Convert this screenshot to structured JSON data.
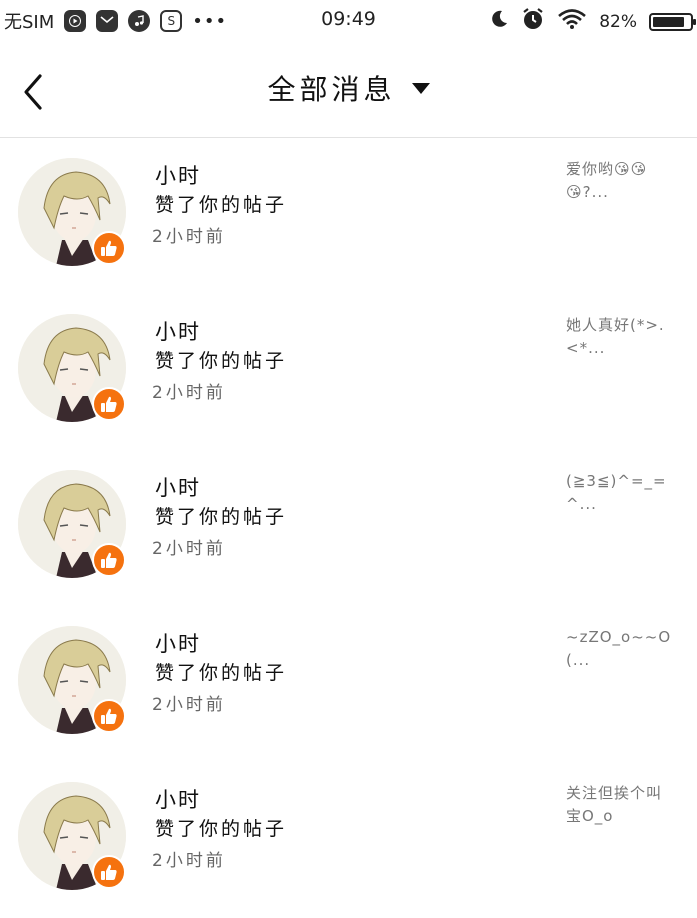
{
  "status_bar": {
    "carrier": "无SIM",
    "time": "09:49",
    "battery_percent": "82%",
    "battery_level": 0.82,
    "app_icons": [
      "play-icon",
      "mail-icon",
      "music-icon",
      "s-icon"
    ],
    "more": "•••"
  },
  "header": {
    "title": "全部消息",
    "back_icon": "chevron-left-icon",
    "dropdown_icon": "caret-down-icon"
  },
  "messages": [
    {
      "name": "小时",
      "action": "赞了你的帖子",
      "time": "2小时前",
      "preview": "爱你哟😘😘😘?..."
    },
    {
      "name": "小时",
      "action": "赞了你的帖子",
      "time": "2小时前",
      "preview": "她人真好(*>.<*..."
    },
    {
      "name": "小时",
      "action": "赞了你的帖子",
      "time": "2小时前",
      "preview": "(≧3≦)^=_=^..."
    },
    {
      "name": "小时",
      "action": "赞了你的帖子",
      "time": "2小时前",
      "preview": "~zZO_o~~O(..."
    },
    {
      "name": "小时",
      "action": "赞了你的帖子",
      "time": "2小时前",
      "preview": "关注但挨个叫宝O_o"
    }
  ],
  "colors": {
    "like_badge": "#f5720f",
    "divider": "#e2e2e2"
  }
}
